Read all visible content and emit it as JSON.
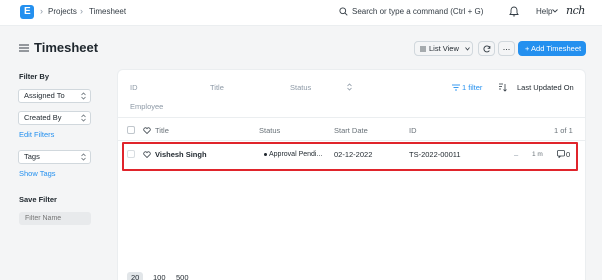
{
  "navbar": {
    "logo_letter": "E",
    "breadcrumbs": [
      "Projects",
      "Timesheet"
    ],
    "search_placeholder": "Search or type a command (Ctrl + G)",
    "help_label": "Help",
    "avatar_text": "nch"
  },
  "page": {
    "title": "Timesheet",
    "list_view_label": "List View",
    "more_label": "...",
    "add_button_label": "+ Add Timesheet"
  },
  "sidebar": {
    "filter_by_label": "Filter By",
    "assigned_to_label": "Assigned To",
    "created_by_label": "Created By",
    "edit_filters_label": "Edit Filters",
    "tags_label": "Tags",
    "show_tags_label": "Show Tags",
    "save_filter_label": "Save Filter",
    "filter_name_placeholder": "Filter Name"
  },
  "filters": {
    "id_placeholder": "ID",
    "title_placeholder": "Title",
    "status_placeholder": "Status",
    "employee_placeholder": "Employee",
    "filter_count_label": "1 filter",
    "sort_label": "Last Updated On"
  },
  "table": {
    "headers": {
      "title": "Title",
      "status": "Status",
      "start_date": "Start Date",
      "id": "ID"
    },
    "count_label": "1 of 1",
    "rows": [
      {
        "title": "Vishesh Singh",
        "status": "Approval Pendi...",
        "start_date": "02-12-2022",
        "id": "TS-2022-00011",
        "assignee": "–",
        "modified": "1 m",
        "comments": "0"
      }
    ]
  },
  "paging": [
    "20",
    "100",
    "500"
  ],
  "colors": {
    "primary": "#2490ef",
    "highlight_border": "#e0242b",
    "background": "#f4f5f6"
  }
}
